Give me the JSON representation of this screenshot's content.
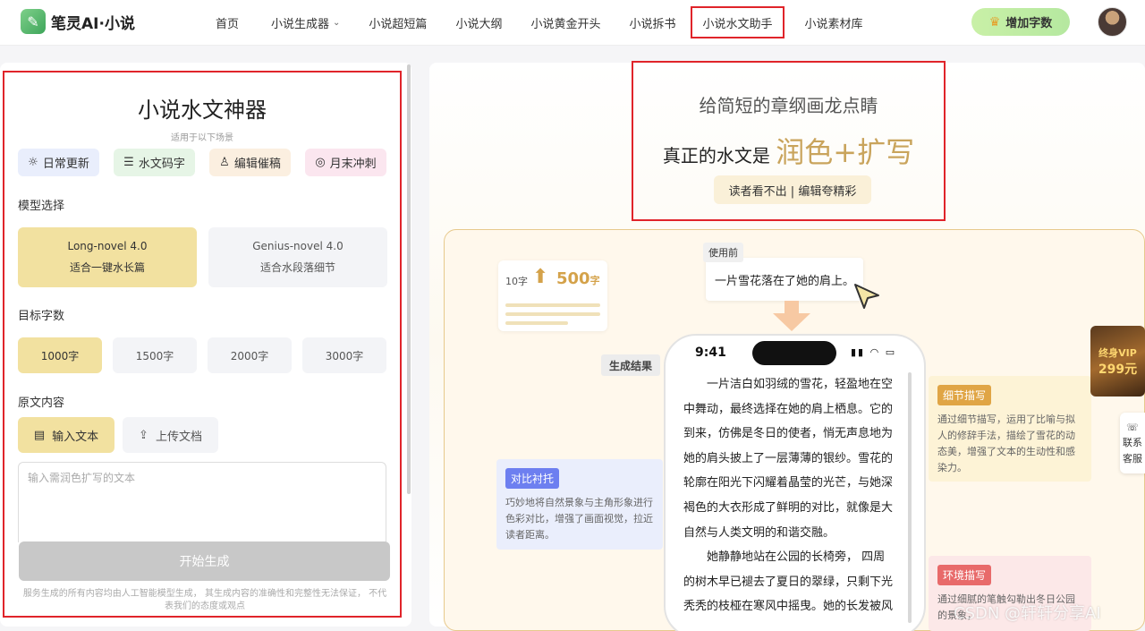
{
  "brand": {
    "logo_text": "笔灵AI·小说"
  },
  "nav": {
    "items": [
      {
        "label": "首页"
      },
      {
        "label": "小说生成器"
      },
      {
        "label": "小说超短篇"
      },
      {
        "label": "小说大纲"
      },
      {
        "label": "小说黄金开头"
      },
      {
        "label": "小说拆书"
      },
      {
        "label": "小说水文助手"
      },
      {
        "label": "小说素材库"
      }
    ],
    "active": "小说水文助手",
    "add_words_label": "增加字数"
  },
  "left": {
    "title": "小说水文神器",
    "subtitle": "适用于以下场景",
    "scenarios": [
      {
        "label": "日常更新",
        "icon": "sun-icon",
        "bg": "#e9eefc"
      },
      {
        "label": "水文码字",
        "icon": "list-icon",
        "bg": "#e6f5e6"
      },
      {
        "label": "编辑催稿",
        "icon": "user-icon",
        "bg": "#fbefe0"
      },
      {
        "label": "月末冲刺",
        "icon": "target-icon",
        "bg": "#fbe6ef"
      }
    ],
    "model_label": "模型选择",
    "models": [
      {
        "name": "Long-novel 4.0",
        "desc": "适合一键水长篇",
        "selected": true
      },
      {
        "name": "Genius-novel 4.0",
        "desc": "适合水段落细节",
        "selected": false
      }
    ],
    "wordcount_label": "目标字数",
    "wordcounts": [
      "1000字",
      "1500字",
      "2000字",
      "3000字"
    ],
    "wordcount_selected": "1000字",
    "source_label": "原文内容",
    "input_text_btn": "输入文本",
    "upload_btn": "上传文档",
    "textarea_placeholder": "输入需润色扩写的文本",
    "generate_btn": "开始生成",
    "disclaimer": "服务生成的所有内容均由人工智能模型生成， 其生成内容的准确性和完整性无法保证， 不代表我们的态度或观点"
  },
  "right": {
    "hero_line1": "给简短的章纲画龙点睛",
    "hero_line2_prefix": "真正的水文是",
    "hero_line2_highlight": "润色+扩写",
    "hero_pill": "读者看不出 | 编辑夸精彩",
    "stat_small": "10字",
    "stat_big": "500",
    "stat_big_unit": "字",
    "before_tag": "使用前",
    "before_text": "一片雪花落在了她的肩上。",
    "result_tag": "生成结果",
    "phone_time": "9:41",
    "phone_para1": "一片洁白如羽绒的雪花，轻盈地在空中舞动，最终选择在她的肩上栖息。它的到来，仿佛是冬日的使者，悄无声息地为她的肩头披上了一层薄薄的银纱。雪花的轮廓在阳光下闪耀着晶莹的光芒，与她深褐色的大衣形成了鲜明的对比，就像是大自然与人类文明的和谐交融。",
    "phone_para2": "她静静地站在公园的长椅旁， 四周的树木早已褪去了夏日的翠绿，只剩下光秃秃的枝桠在寒风中摇曳。她的长发被风",
    "cards": [
      {
        "title": "细节描写",
        "body": "通过细节描写，运用了比喻与拟人的修辞手法，描绘了雪花的动态美，增强了文本的生动性和感染力。",
        "color": "#e0a545"
      },
      {
        "title": "对比衬托",
        "body": "巧妙地将自然景象与主角形象进行色彩对比，增强了画面视觉，拉近读者距离。",
        "color": "#6d7ff0"
      },
      {
        "title": "环境描写",
        "body": "通过细腻的笔触勾勒出冬日公园的景象，",
        "color": "#e86a6a"
      }
    ],
    "vip_line1": "终身VIP",
    "vip_line2": "299元",
    "contact_line1": "联系",
    "contact_line2": "客服",
    "watermark": "CSDN @轩轩分享AI"
  }
}
